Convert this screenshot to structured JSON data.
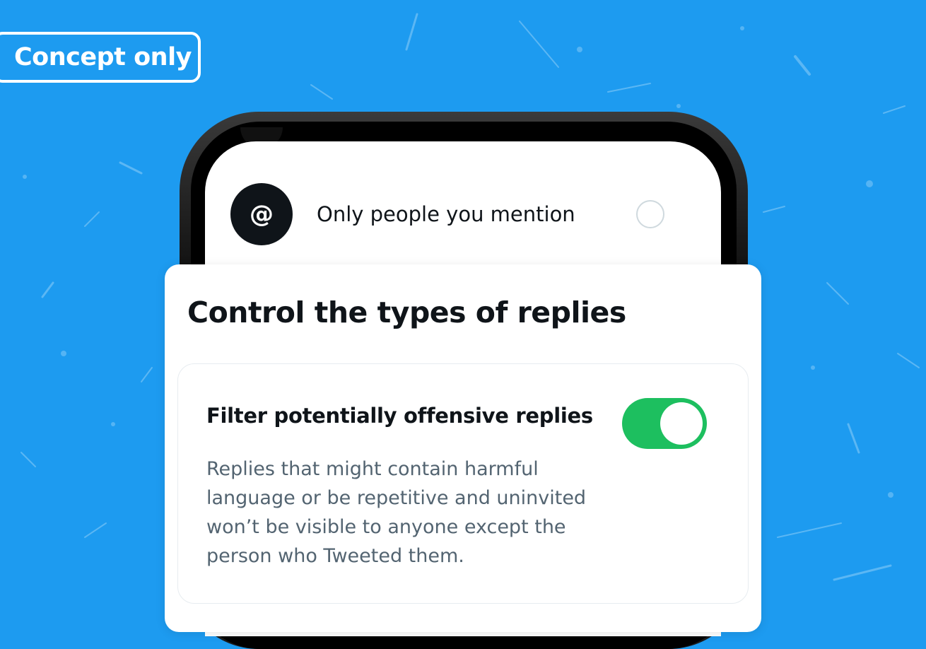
{
  "badge": {
    "label": "Concept only"
  },
  "reply_options": {
    "mention_icon_glyph": "@",
    "mention_label": "Only people you mention",
    "mention_selected": false
  },
  "settings_card": {
    "title": "Control the types of replies",
    "filter": {
      "title": "Filter potentially offensive replies",
      "enabled": true,
      "description": "Replies that might contain harmful language or be repetitive and uninvited won’t be visible to anyone except the person who Tweeted them."
    }
  },
  "colors": {
    "background": "#1d9bf0",
    "toggle_on": "#1dbf5f",
    "text_primary": "#0f1419",
    "text_secondary": "#536471"
  },
  "icons": {
    "mention": "at-icon",
    "radio": "radio-unselected-icon"
  }
}
